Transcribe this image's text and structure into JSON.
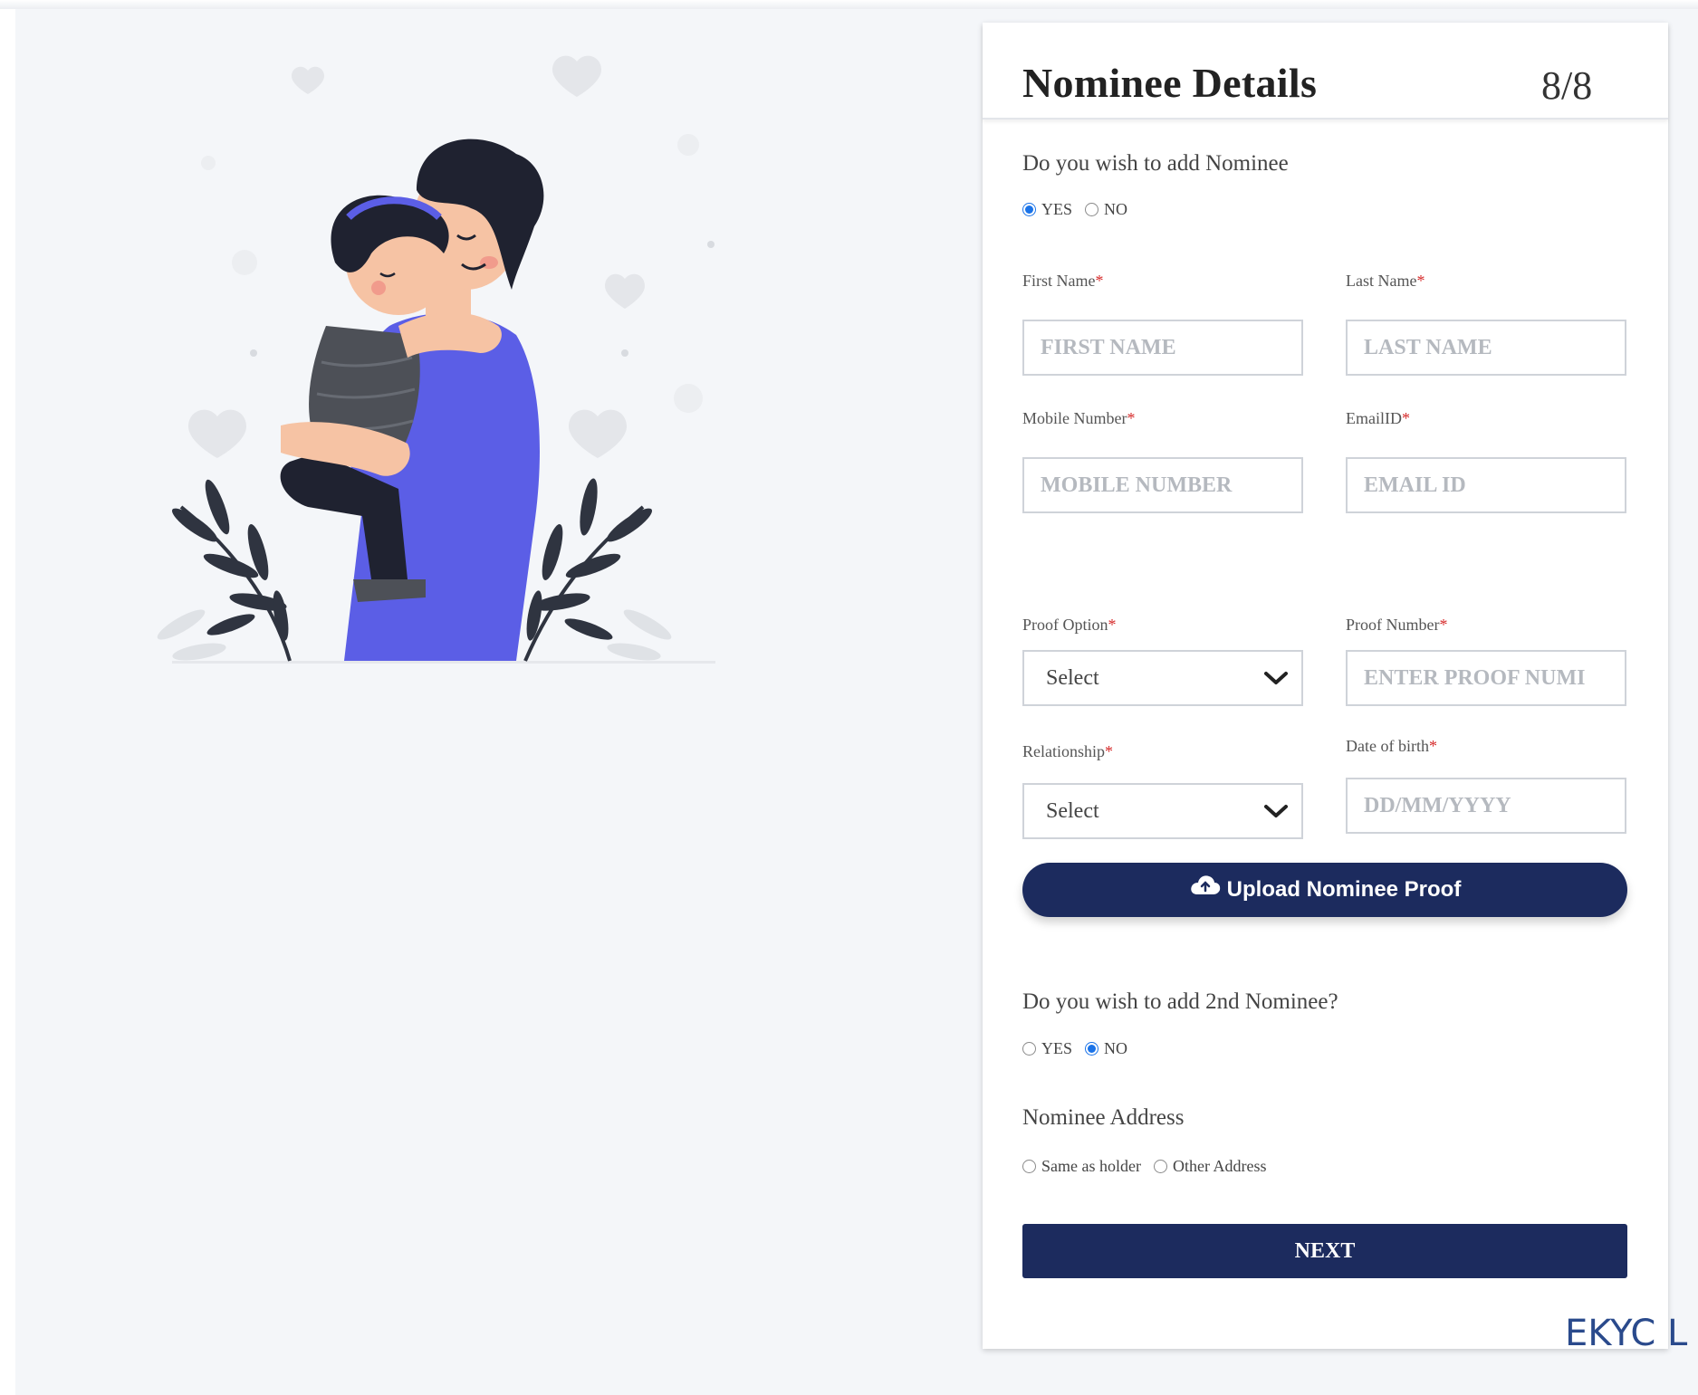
{
  "card": {
    "title": "Nominee Details",
    "step": "8/8"
  },
  "nominee1": {
    "question": "Do you wish to add Nominee",
    "options": [
      "YES",
      "NO"
    ],
    "selected": "YES"
  },
  "fields": {
    "first_name": {
      "label": "First Name",
      "placeholder": "FIRST NAME"
    },
    "last_name": {
      "label": "Last Name",
      "placeholder": "LAST NAME"
    },
    "mobile": {
      "label": "Mobile Number",
      "placeholder": "MOBILE NUMBER"
    },
    "email": {
      "label": "EmailID",
      "placeholder": "EMAIL ID"
    },
    "proof_option": {
      "label": "Proof Option",
      "value": "Select"
    },
    "proof_number": {
      "label": "Proof Number",
      "placeholder": "ENTER PROOF NUMI"
    },
    "relationship": {
      "label": "Relationship",
      "value": "Select"
    },
    "dob": {
      "label": "Date of birth",
      "placeholder": "DD/MM/YYYY"
    },
    "required_mark": "*"
  },
  "upload": {
    "label": "Upload Nominee Proof",
    "icon": "cloud-upload-icon"
  },
  "nominee2": {
    "question": "Do you wish to add 2nd Nominee?",
    "options": [
      "YES",
      "NO"
    ],
    "selected": "NO"
  },
  "address": {
    "question": "Nominee Address",
    "options": [
      "Same as holder",
      "Other Address"
    ],
    "selected": null
  },
  "next_label": "NEXT",
  "watermark": "EKYC L",
  "colors": {
    "primary": "#1c2b5e",
    "radio_checked": "#1a73e8",
    "required": "#d62b2b",
    "illustration_blue": "#5b5ee6"
  }
}
